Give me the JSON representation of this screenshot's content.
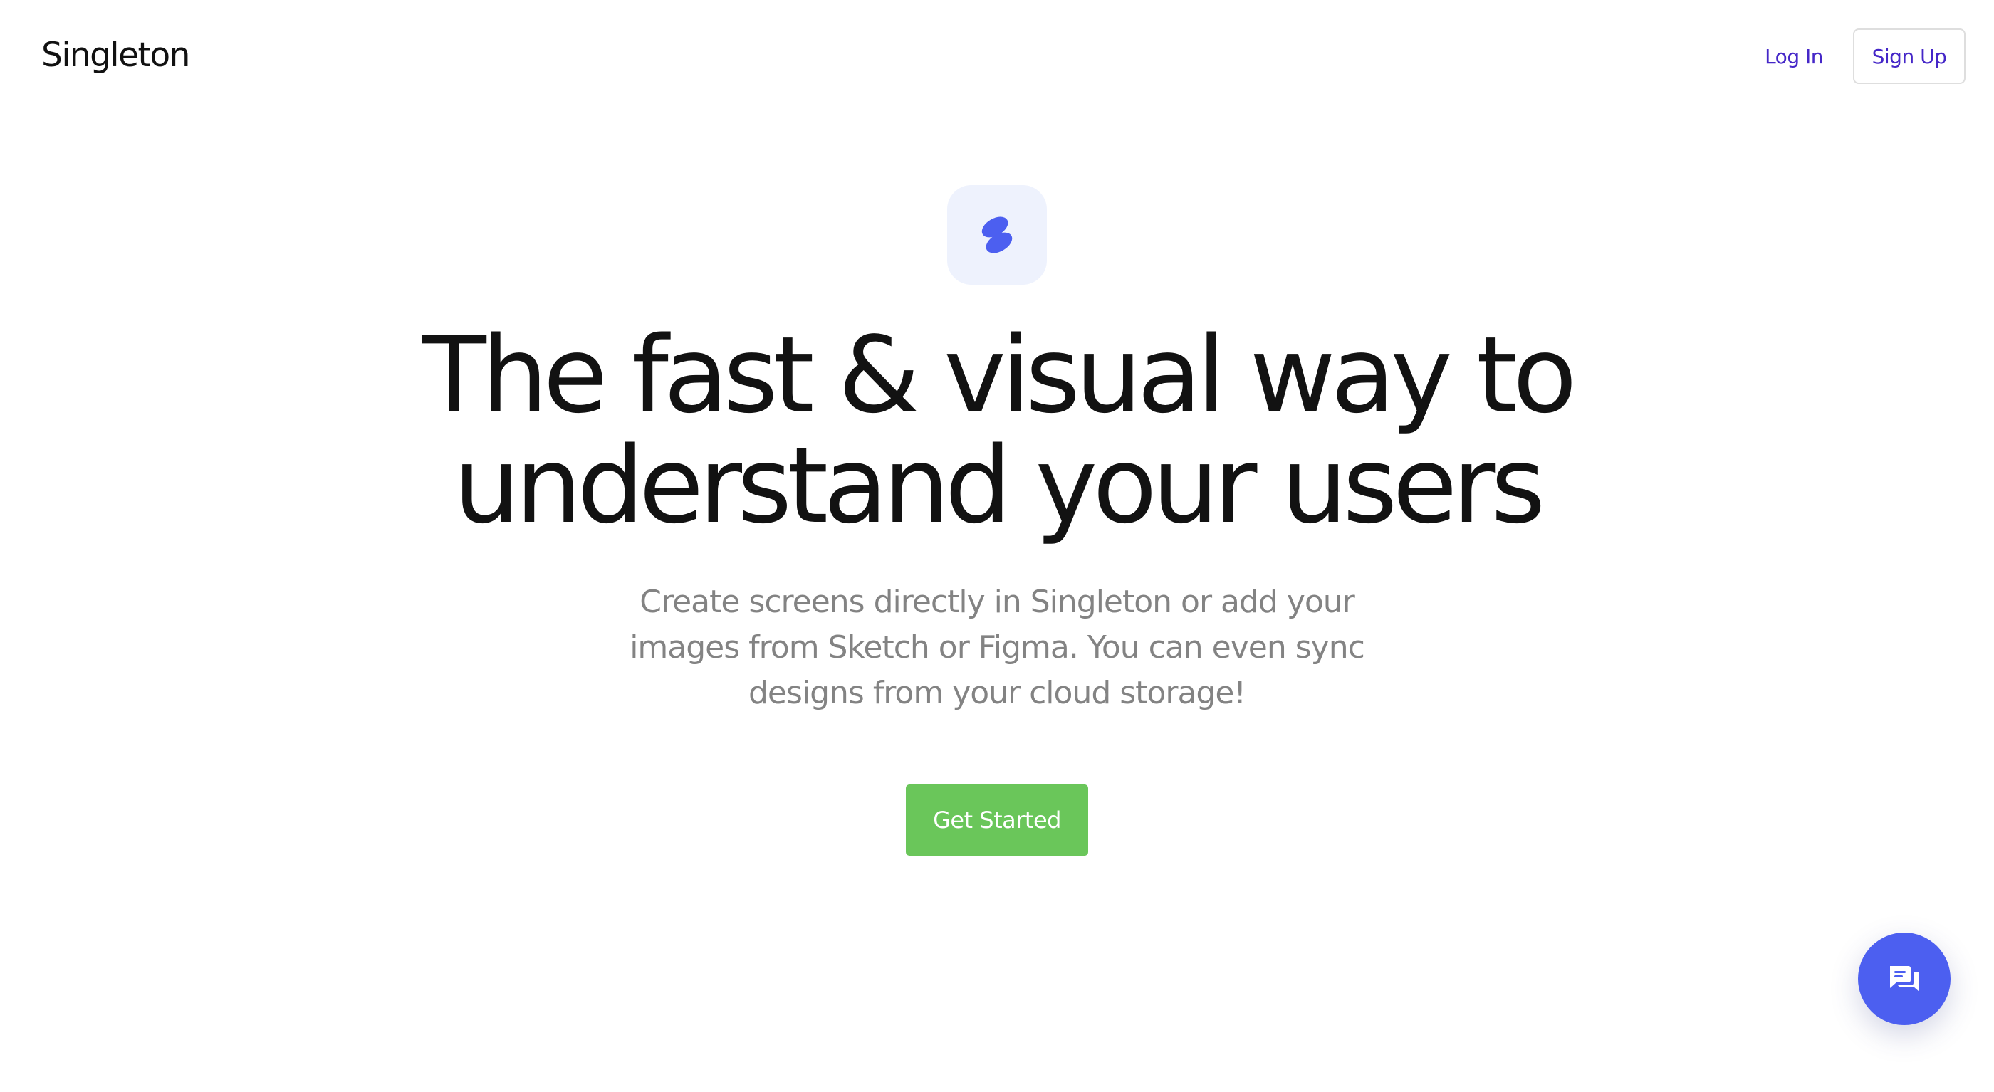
{
  "header": {
    "brand": "Singleton",
    "login_label": "Log In",
    "signup_label": "Sign Up"
  },
  "hero": {
    "logo_icon": "singleton-s-icon",
    "headline_line1": "The fast & visual way to",
    "headline_line2": "understand your users",
    "subtitle_line1": "Create screens directly in Singleton or add your",
    "subtitle_line2": "images from Sketch or Figma. You can even sync",
    "subtitle_line3": "designs from your cloud storage!",
    "cta_label": "Get Started"
  },
  "chat_widget": {
    "icon": "chat-bubbles-icon"
  },
  "colors": {
    "accent": "#4527c8",
    "logo_blue": "#4c5ff0",
    "cta_green": "#6ac65a",
    "logo_tile_bg": "#eef2fd"
  }
}
